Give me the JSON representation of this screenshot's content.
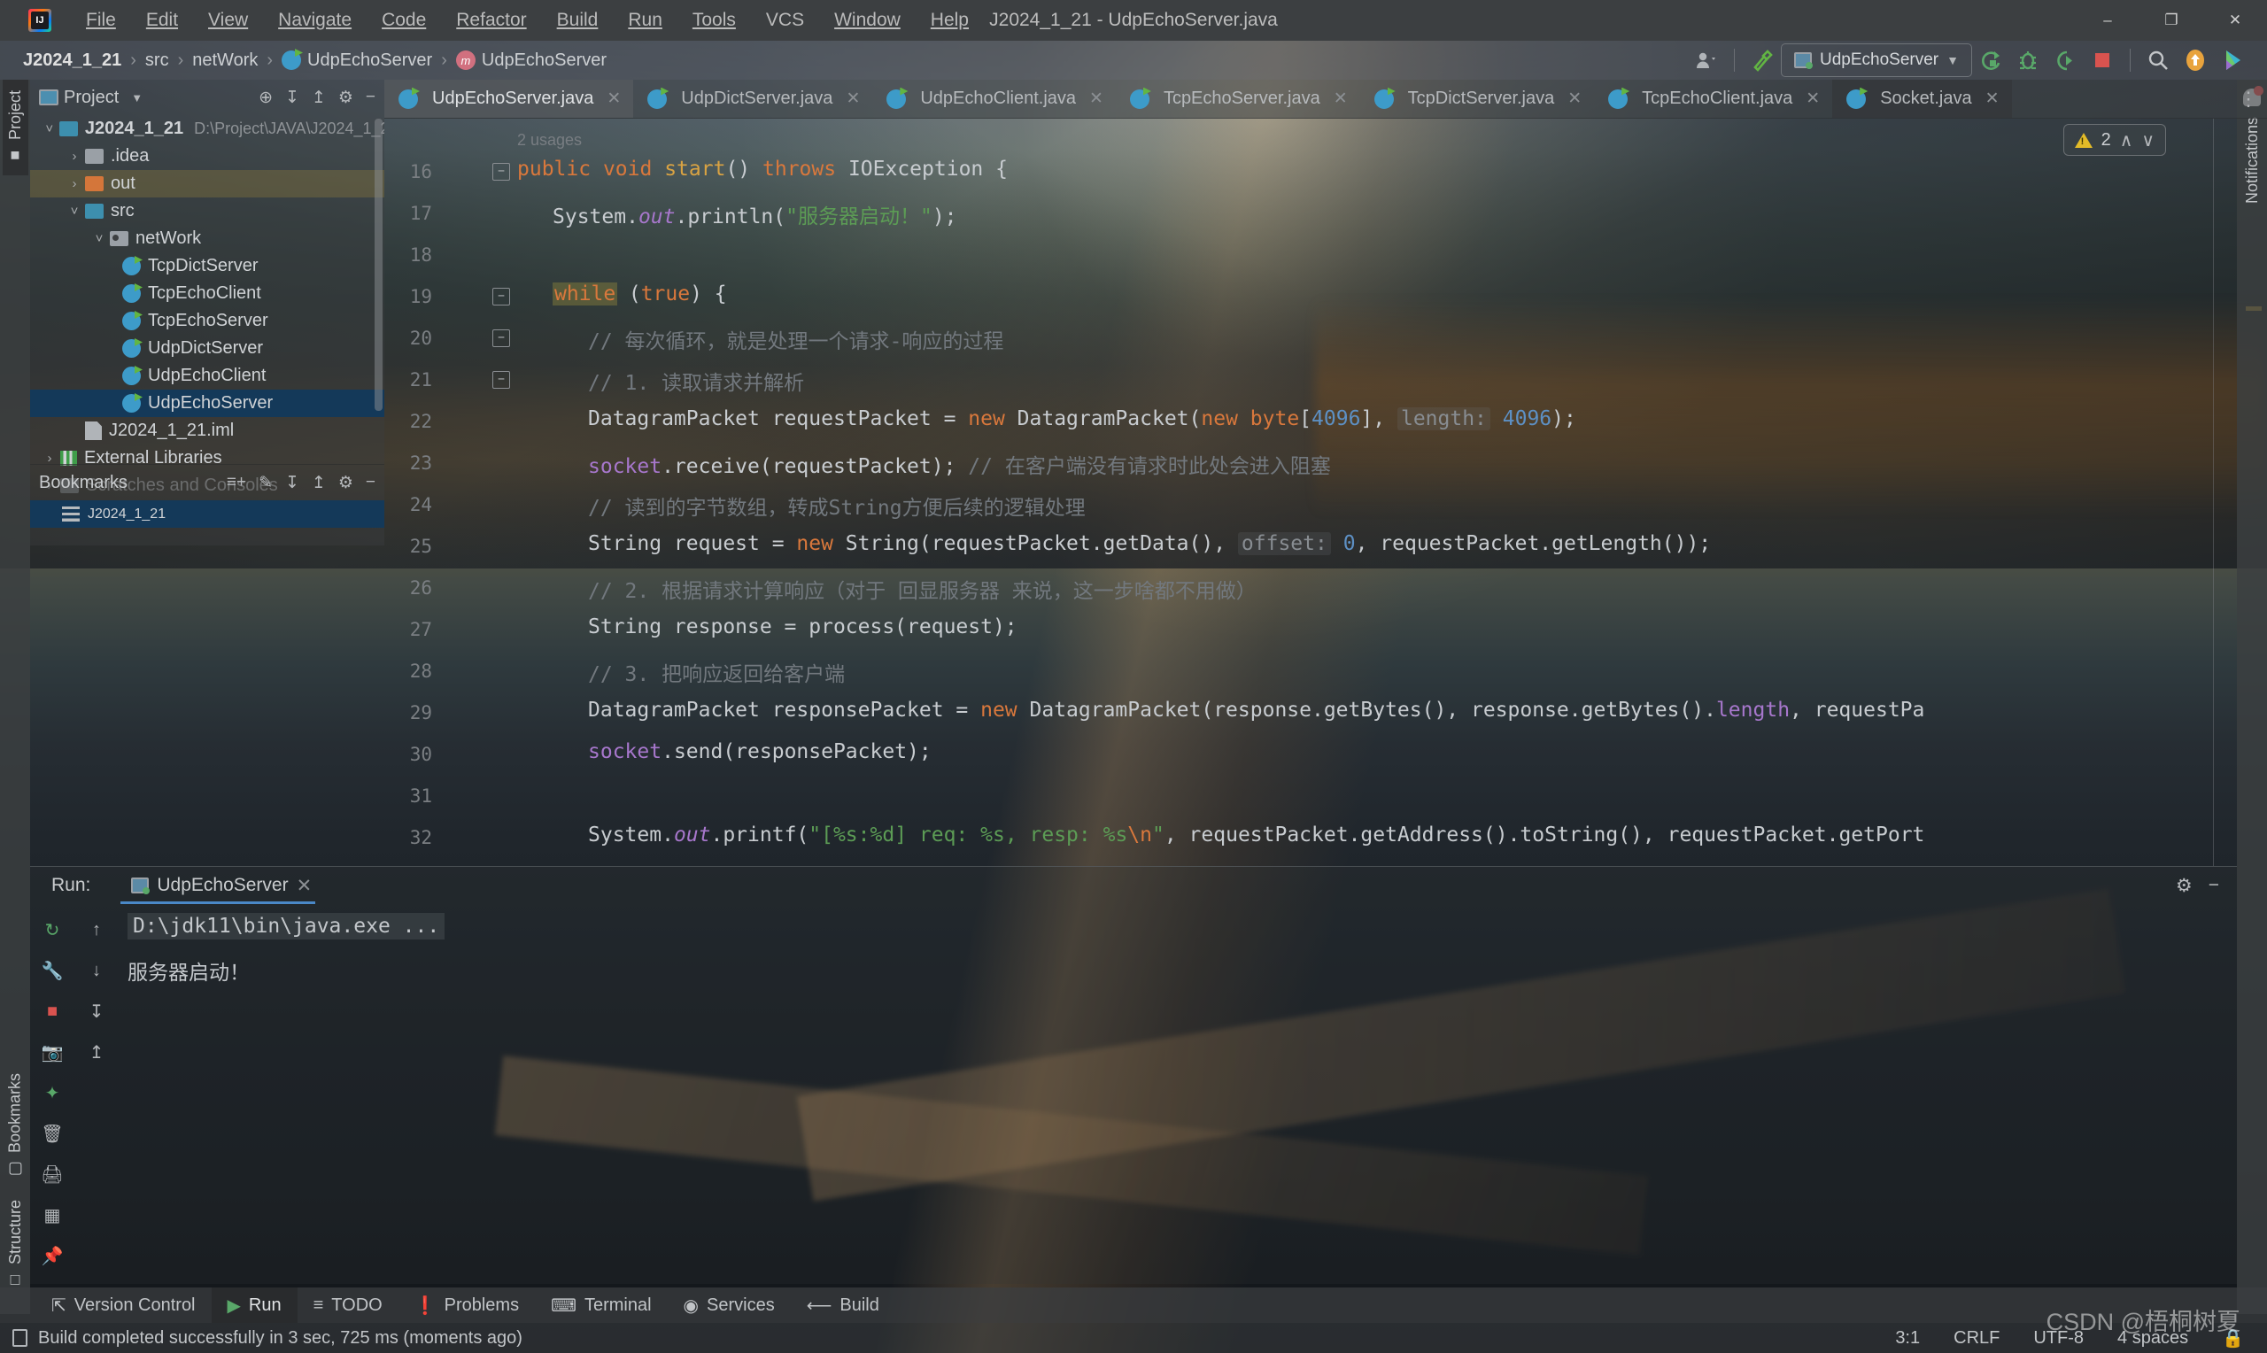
{
  "window": {
    "title": "J2024_1_21 - UdpEchoServer.java",
    "menu": [
      "File",
      "Edit",
      "View",
      "Navigate",
      "Code",
      "Refactor",
      "Build",
      "Run",
      "Tools",
      "VCS",
      "Window",
      "Help"
    ],
    "buttons": {
      "minimize": "–",
      "maximize": "❐",
      "close": "✕"
    }
  },
  "navbar": {
    "breadcrumbs": [
      "J2024_1_21",
      "src",
      "netWork",
      "UdpEchoServer",
      "UdpEchoServer"
    ],
    "separator": "›",
    "run_config": "UdpEchoServer",
    "run_config_caret": "▼",
    "icons": [
      "user-avatar-icon",
      "build-hammer-icon",
      "run-icon",
      "debug-icon",
      "run-coverage-icon",
      "stop-icon",
      "search-everywhere-icon",
      "update-project-icon",
      "ide-assistant-icon"
    ]
  },
  "editor_tabs": [
    {
      "label": "UdpEchoServer.java",
      "active": true
    },
    {
      "label": "UdpDictServer.java",
      "active": false
    },
    {
      "label": "UdpEchoClient.java",
      "active": false
    },
    {
      "label": "TcpEchoServer.java",
      "active": false
    },
    {
      "label": "TcpDictServer.java",
      "active": false
    },
    {
      "label": "TcpEchoClient.java",
      "active": false
    },
    {
      "label": "Socket.java",
      "active": false
    }
  ],
  "left_stripe": [
    {
      "label": "Project",
      "selected": true
    },
    {
      "label": "Bookmarks",
      "selected": false
    },
    {
      "label": "Structure",
      "selected": false
    }
  ],
  "right_stripe": {
    "label": "Notifications"
  },
  "project_panel": {
    "title": "Project",
    "title_caret": "▼",
    "actions": [
      "locate-icon",
      "expand-all-icon",
      "collapse-all-icon",
      "settings-gear-icon",
      "hide-icon"
    ],
    "tree": [
      {
        "label": "J2024_1_21",
        "path": "D:\\Project\\JAVA\\J2024_1_2",
        "indent": 0,
        "arrow": "˅",
        "icon": "module-folder",
        "state": "normal"
      },
      {
        "label": ".idea",
        "path": "",
        "indent": 1,
        "arrow": "›",
        "icon": "folder-gray",
        "state": "normal"
      },
      {
        "label": "out",
        "path": "",
        "indent": 1,
        "arrow": "›",
        "icon": "folder-orange",
        "state": "hover"
      },
      {
        "label": "src",
        "path": "",
        "indent": 1,
        "arrow": "˅",
        "icon": "folder-src",
        "state": "normal"
      },
      {
        "label": "netWork",
        "path": "",
        "indent": 2,
        "arrow": "˅",
        "icon": "folder-package",
        "state": "normal"
      },
      {
        "label": "TcpDictServer",
        "path": "",
        "indent": 3,
        "arrow": "",
        "icon": "java-class",
        "state": "normal"
      },
      {
        "label": "TcpEchoClient",
        "path": "",
        "indent": 3,
        "arrow": "",
        "icon": "java-class",
        "state": "normal"
      },
      {
        "label": "TcpEchoServer",
        "path": "",
        "indent": 3,
        "arrow": "",
        "icon": "java-class",
        "state": "normal"
      },
      {
        "label": "UdpDictServer",
        "path": "",
        "indent": 3,
        "arrow": "",
        "icon": "java-class",
        "state": "normal"
      },
      {
        "label": "UdpEchoClient",
        "path": "",
        "indent": 3,
        "arrow": "",
        "icon": "java-class",
        "state": "normal"
      },
      {
        "label": "UdpEchoServer",
        "path": "",
        "indent": 3,
        "arrow": "",
        "icon": "java-class",
        "state": "selected"
      },
      {
        "label": "J2024_1_21.iml",
        "path": "",
        "indent": 1,
        "arrow": "",
        "icon": "iml-file",
        "state": "normal"
      },
      {
        "label": "External Libraries",
        "path": "",
        "indent": 0,
        "arrow": "›",
        "icon": "libraries",
        "state": "normal"
      },
      {
        "label": "Scratches and Consoles",
        "path": "",
        "indent": 0,
        "arrow": "›",
        "icon": "scratches",
        "state": "normal"
      }
    ]
  },
  "bookmarks_panel": {
    "title": "Bookmarks",
    "actions": [
      "add-bookmark-icon",
      "edit-icon",
      "expand-all-icon",
      "collapse-all-icon",
      "settings-gear-icon",
      "hide-icon"
    ],
    "items": [
      {
        "label": "J2024_1_21",
        "selected": true
      }
    ]
  },
  "editor": {
    "usages_hint": "2 usages",
    "inspections": {
      "warning_count": "2",
      "up": "∧",
      "down": "∨"
    },
    "lines": [
      {
        "num": "16",
        "fold": "−"
      },
      {
        "num": "17",
        "fold": ""
      },
      {
        "num": "18",
        "fold": ""
      },
      {
        "num": "19",
        "fold": "−"
      },
      {
        "num": "20",
        "fold": "−"
      },
      {
        "num": "21",
        "fold": "−"
      },
      {
        "num": "22",
        "fold": ""
      },
      {
        "num": "23",
        "fold": ""
      },
      {
        "num": "24",
        "fold": ""
      },
      {
        "num": "25",
        "fold": ""
      },
      {
        "num": "26",
        "fold": ""
      },
      {
        "num": "27",
        "fold": ""
      },
      {
        "num": "28",
        "fold": ""
      },
      {
        "num": "29",
        "fold": ""
      },
      {
        "num": "30",
        "fold": ""
      },
      {
        "num": "31",
        "fold": ""
      },
      {
        "num": "32",
        "fold": ""
      }
    ],
    "code": {
      "l16": "public void start() throws IOException {",
      "l17": "System.out.println(\"服务器启动！\");",
      "l19": "while (true) {",
      "l20": "// 每次循环，就是处理一个请求-响应的过程",
      "l21": "// 1. 读取请求并解析",
      "l22": "DatagramPacket requestPacket = new DatagramPacket(new byte[4096], length: 4096);",
      "l23": "socket.receive(requestPacket); // 在客户端没有请求时此处会进入阻塞",
      "l24": "// 读到的字节数组，转成String方便后续的逻辑处理",
      "l25": "String request = new String(requestPacket.getData(), offset: 0, requestPacket.getLength());",
      "l26": "// 2. 根据请求计算响应（对于 回显服务器 来说，这一步啥都不用做）",
      "l27": "String response = process(request);",
      "l28": "// 3. 把响应返回给客户端",
      "l29": "DatagramPacket responsePacket = new DatagramPacket(response.getBytes(), response.getBytes().length, requestPa",
      "l30": "socket.send(responsePacket);",
      "l32": "System.out.printf(\"[%s:%d] req: %s, resp: %s\\n\", requestPacket.getAddress().toString(), requestPacket.getPort"
    }
  },
  "run_panel": {
    "label": "Run:",
    "tab": "UdpEchoServer",
    "tab_close": "✕",
    "actions": [
      "rerun-icon",
      "settings-gear-icon",
      "hide-icon"
    ],
    "sidebar_icons": [
      "rerun-icon",
      "wrench-icon",
      "stop-icon",
      "camera-icon",
      "thread-dump-icon",
      "trash-icon",
      "print-icon",
      "layout-icon",
      "pin-icon",
      "scroll-up-icon",
      "scroll-down-icon",
      "soft-wrap-icon",
      "scroll-to-end-icon"
    ],
    "console": [
      "D:\\jdk11\\bin\\java.exe ...",
      "服务器启动！"
    ]
  },
  "bottom_toolbar": [
    {
      "label": "Version Control",
      "icon": "branch-icon",
      "selected": false
    },
    {
      "label": "Run",
      "icon": "run-icon",
      "selected": true
    },
    {
      "label": "TODO",
      "icon": "todo-icon",
      "selected": false
    },
    {
      "label": "Problems",
      "icon": "problems-icon",
      "selected": false
    },
    {
      "label": "Terminal",
      "icon": "terminal-icon",
      "selected": false
    },
    {
      "label": "Services",
      "icon": "services-icon",
      "selected": false
    },
    {
      "label": "Build",
      "icon": "build-icon",
      "selected": false
    }
  ],
  "status_bar": {
    "message": "Build completed successfully in 3 sec, 725 ms (moments ago)",
    "caret_position": "3:1",
    "line_separator": "CRLF",
    "encoding": "UTF-8",
    "indent": "4 spaces",
    "lock_icon": "lock-icon"
  },
  "watermark": "CSDN @梧桐树夏",
  "colors": {
    "accent_blue": "#4a88c7",
    "selection_blue": "#11395c",
    "keyword_orange": "#d9783c",
    "string_green": "#5c9c55",
    "number_blue": "#5d90c4",
    "comment_gray": "#72787e",
    "field_purple": "#a777cc",
    "warning_yellow": "#e3bb28",
    "titlebar_bg": "#3c3f41"
  }
}
